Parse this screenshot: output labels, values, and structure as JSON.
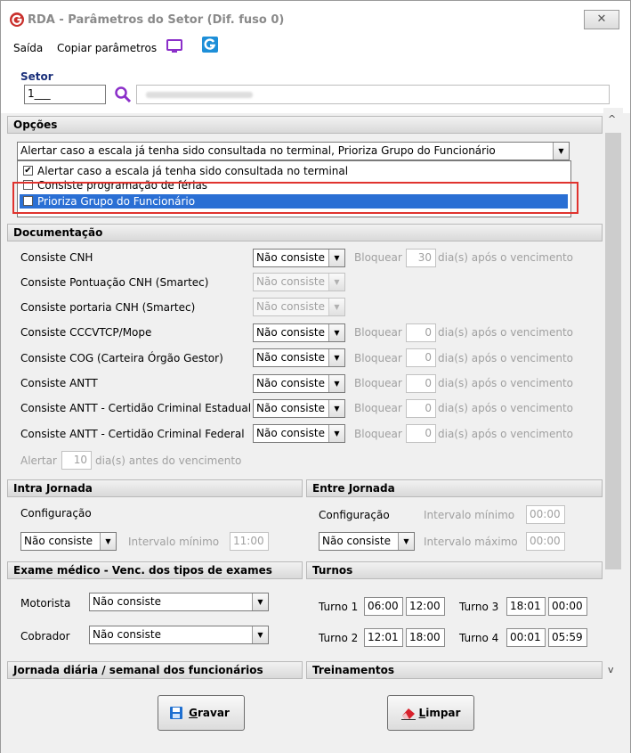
{
  "window": {
    "title": "RDA - Parâmetros do Setor (Dif. fuso 0)",
    "close_glyph": "✕",
    "accent_color": "#e0332e",
    "selection_color": "#2a6fd4"
  },
  "menu": {
    "items": [
      "Saída",
      "Copiar parâmetros"
    ],
    "icons": [
      "monitor-icon",
      "g-icon"
    ]
  },
  "setor": {
    "label": "Setor",
    "code": "1___"
  },
  "opcoes": {
    "header": "Opções",
    "combo_value": "Alertar caso a escala já tenha sido consultada no terminal, Prioriza Grupo do Funcionário",
    "list": [
      {
        "label": "Alertar caso a escala já tenha sido consultada no terminal",
        "checked": true,
        "selected": false
      },
      {
        "label": "Consiste programação de férias",
        "checked": false,
        "selected": false
      },
      {
        "label": "Prioriza Grupo do Funcionário",
        "checked": true,
        "selected": true
      }
    ]
  },
  "documentacao": {
    "header": "Documentação",
    "rows": [
      {
        "label": "Consiste CNH",
        "value": "Não consiste",
        "enabled": true,
        "bloquear": "Bloquear",
        "days": "30",
        "suffix": "dia(s) após o vencimento"
      },
      {
        "label": "Consiste Pontuação CNH (Smartec)",
        "value": "Não consiste",
        "enabled": false
      },
      {
        "label": "Consiste portaria CNH (Smartec)",
        "value": "Não consiste",
        "enabled": false
      },
      {
        "label": "Consiste CCCVTCP/Mope",
        "value": "Não consiste",
        "enabled": true,
        "bloquear": "Bloquear",
        "days": "0",
        "suffix": "dia(s) após o vencimento"
      },
      {
        "label": "Consiste COG (Carteira Órgão Gestor)",
        "value": "Não consiste",
        "enabled": true,
        "bloquear": "Bloquear",
        "days": "0",
        "suffix": "dia(s) após o vencimento"
      },
      {
        "label": "Consiste ANTT",
        "value": "Não consiste",
        "enabled": true,
        "bloquear": "Bloquear",
        "days": "0",
        "suffix": "dia(s) após o vencimento"
      },
      {
        "label": "Consiste ANTT - Certidão Criminal Estadual",
        "value": "Não consiste",
        "enabled": true,
        "bloquear": "Bloquear",
        "days": "0",
        "suffix": "dia(s) após o vencimento"
      },
      {
        "label": "Consiste ANTT - Certidão Criminal Federal",
        "value": "Não consiste",
        "enabled": true,
        "bloquear": "Bloquear",
        "days": "0",
        "suffix": "dia(s) após o vencimento"
      }
    ],
    "alertar": {
      "label": "Alertar",
      "days": "10",
      "suffix": "dia(s) antes do vencimento"
    }
  },
  "intra": {
    "header": "Intra Jornada",
    "config_label": "Configuração",
    "value": "Não consiste",
    "intervalo_label": "Intervalo mínimo",
    "intervalo": "11:00"
  },
  "entre": {
    "header": "Entre Jornada",
    "config_label": "Configuração",
    "value": "Não consiste",
    "min_label": "Intervalo mínimo",
    "min": "00:00",
    "max_label": "Intervalo máximo",
    "max": "00:00"
  },
  "exame": {
    "header": "Exame médico - Venc. dos tipos de exames",
    "motorista_label": "Motorista",
    "motorista": "Não consiste",
    "cobrador_label": "Cobrador",
    "cobrador": "Não consiste"
  },
  "turnos": {
    "header": "Turnos",
    "items": [
      {
        "label": "Turno 1",
        "start": "06:00",
        "end": "12:00"
      },
      {
        "label": "Turno 2",
        "start": "12:01",
        "end": "18:00"
      },
      {
        "label": "Turno 3",
        "start": "18:01",
        "end": "00:00"
      },
      {
        "label": "Turno 4",
        "start": "00:01",
        "end": "05:59"
      }
    ]
  },
  "jornada": {
    "header": "Jornada diária / semanal dos funcionários"
  },
  "treinamentos": {
    "header": "Treinamentos"
  },
  "buttons": {
    "gravar_first": "G",
    "gravar_rest": "ravar",
    "limpar_first": "L",
    "limpar_rest": "impar"
  }
}
